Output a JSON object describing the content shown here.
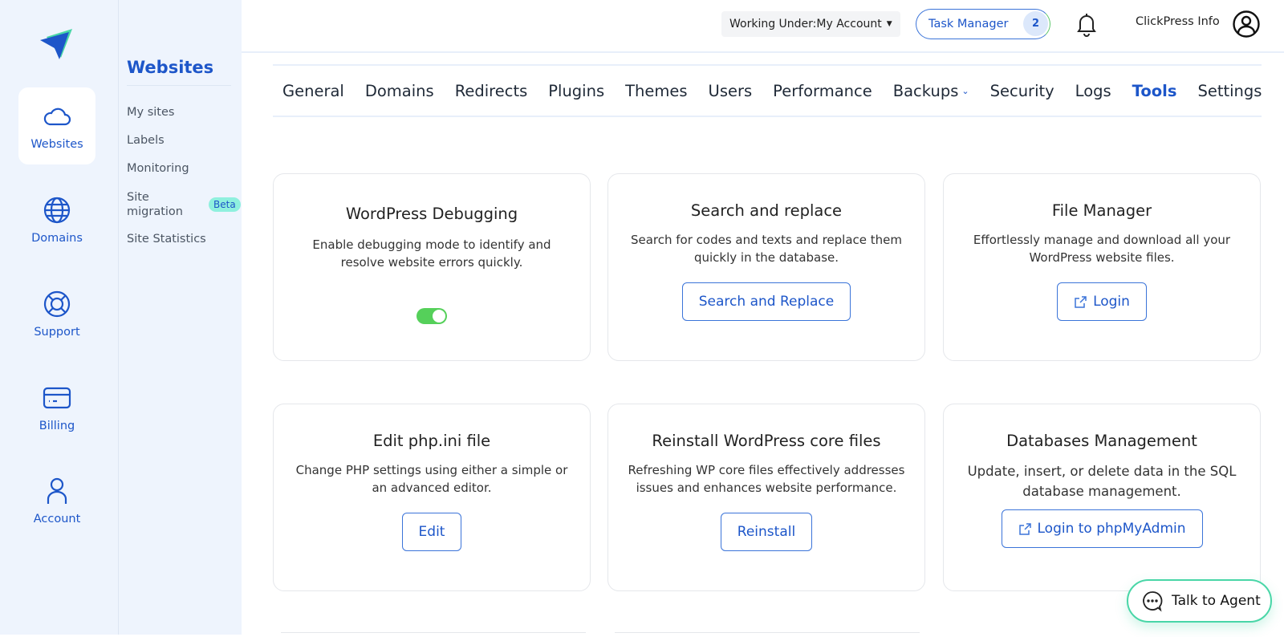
{
  "brand": {
    "logo": "paper-plane-logo",
    "colors": {
      "primary": "#1d56c9",
      "accent": "#49d6a7",
      "toggle_on": "#55d05a"
    }
  },
  "rail": {
    "items": [
      {
        "label": "Websites",
        "icon": "cloud-icon",
        "active": true
      },
      {
        "label": "Domains",
        "icon": "globe-icon",
        "active": false
      },
      {
        "label": "Support",
        "icon": "lifebuoy-icon",
        "active": false
      },
      {
        "label": "Billing",
        "icon": "credit-card-icon",
        "active": false
      },
      {
        "label": "Account",
        "icon": "user-icon",
        "active": false
      }
    ]
  },
  "subnav": {
    "title": "Websites",
    "items": [
      {
        "label": "My sites"
      },
      {
        "label": "Labels"
      },
      {
        "label": "Monitoring"
      },
      {
        "label": "Site migration",
        "badge": "Beta"
      },
      {
        "label": "Site Statistics"
      }
    ]
  },
  "topbar": {
    "working_under": "Working Under:My Account",
    "task_manager": "Task Manager",
    "task_count": "2",
    "username": "ClickPress Info"
  },
  "tabs": [
    {
      "label": "General"
    },
    {
      "label": "Domains"
    },
    {
      "label": "Redirects"
    },
    {
      "label": "Plugins"
    },
    {
      "label": "Themes"
    },
    {
      "label": "Users"
    },
    {
      "label": "Performance"
    },
    {
      "label": "Backups",
      "dropdown": true
    },
    {
      "label": "Security"
    },
    {
      "label": "Logs"
    },
    {
      "label": "Tools",
      "active": true
    },
    {
      "label": "Settings"
    }
  ],
  "cards": [
    {
      "title": "WordPress Debugging",
      "desc": "Enable debugging mode to identify and resolve website errors quickly.",
      "control": "toggle",
      "toggle_on": true
    },
    {
      "title": "Search and replace",
      "desc": "Search for codes and texts and replace them quickly in the database.",
      "button": "Search and Replace"
    },
    {
      "title": "File Manager",
      "desc": "Effortlessly manage and download all your WordPress website files.",
      "button": "Login",
      "button_icon": "external-link-icon"
    },
    {
      "title": "Edit php.ini file",
      "desc": "Change PHP settings using either a simple or an advanced editor.",
      "button": "Edit"
    },
    {
      "title": "Reinstall WordPress core files",
      "desc": "Refreshing WP core files effectively addresses issues and enhances website performance.",
      "button": "Reinstall"
    },
    {
      "title": "Databases Management",
      "desc": "Update, insert, or delete data in the SQL database management.",
      "button": "Login to phpMyAdmin",
      "button_icon": "external-link-icon"
    }
  ],
  "chat": {
    "label": "Talk to Agent"
  }
}
